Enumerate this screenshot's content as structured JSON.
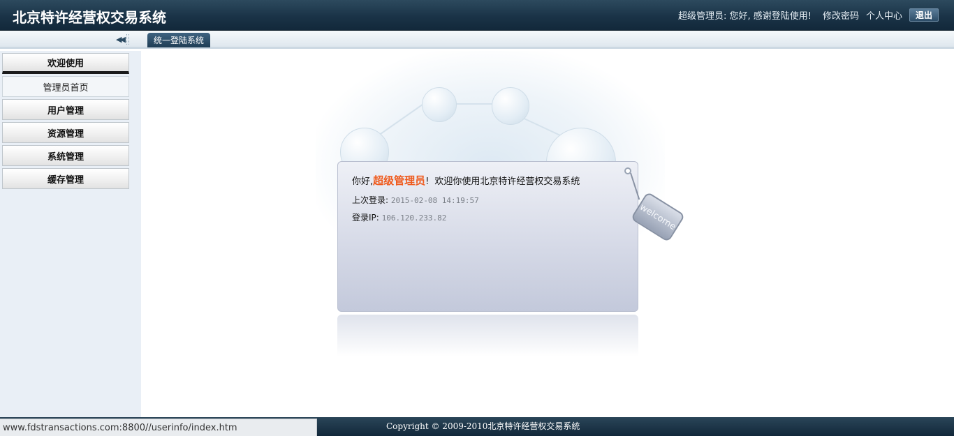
{
  "header": {
    "title": "北京特许经营权交易系统",
    "greeting": "超级管理员: 您好, 感谢登陆使用!",
    "change_password": "修改密码",
    "profile": "个人中心",
    "logout": "退出"
  },
  "tabs": [
    {
      "label": "统一登陆系统"
    }
  ],
  "sidebar": {
    "items": [
      {
        "label": "欢迎使用",
        "active": true
      },
      {
        "label": "管理员首页"
      },
      {
        "label": "用户管理"
      },
      {
        "label": "资源管理"
      },
      {
        "label": "系统管理"
      },
      {
        "label": "缓存管理"
      }
    ]
  },
  "welcome": {
    "hello": "你好,",
    "admin_name": "超级管理员",
    "exclaim": "!",
    "message": "欢迎你使用北京特许经营权交易系统",
    "last_login_label": "上次登录:",
    "last_login_value": "2015-02-08 14:19:57",
    "ip_label": "登录IP:",
    "ip_value": "106.120.233.82",
    "tag_text": "welcome"
  },
  "footer": {
    "copyright": "Copyright © 2009-2010北京特许经营权交易系统"
  },
  "statusbar": {
    "url": "www.fdstransactions.com:8800//userinfo/index.htm"
  },
  "colors": {
    "header_bg": "#1a3347",
    "accent_orange": "#ef5a1d",
    "sidebar_bg": "#e9eff6"
  }
}
